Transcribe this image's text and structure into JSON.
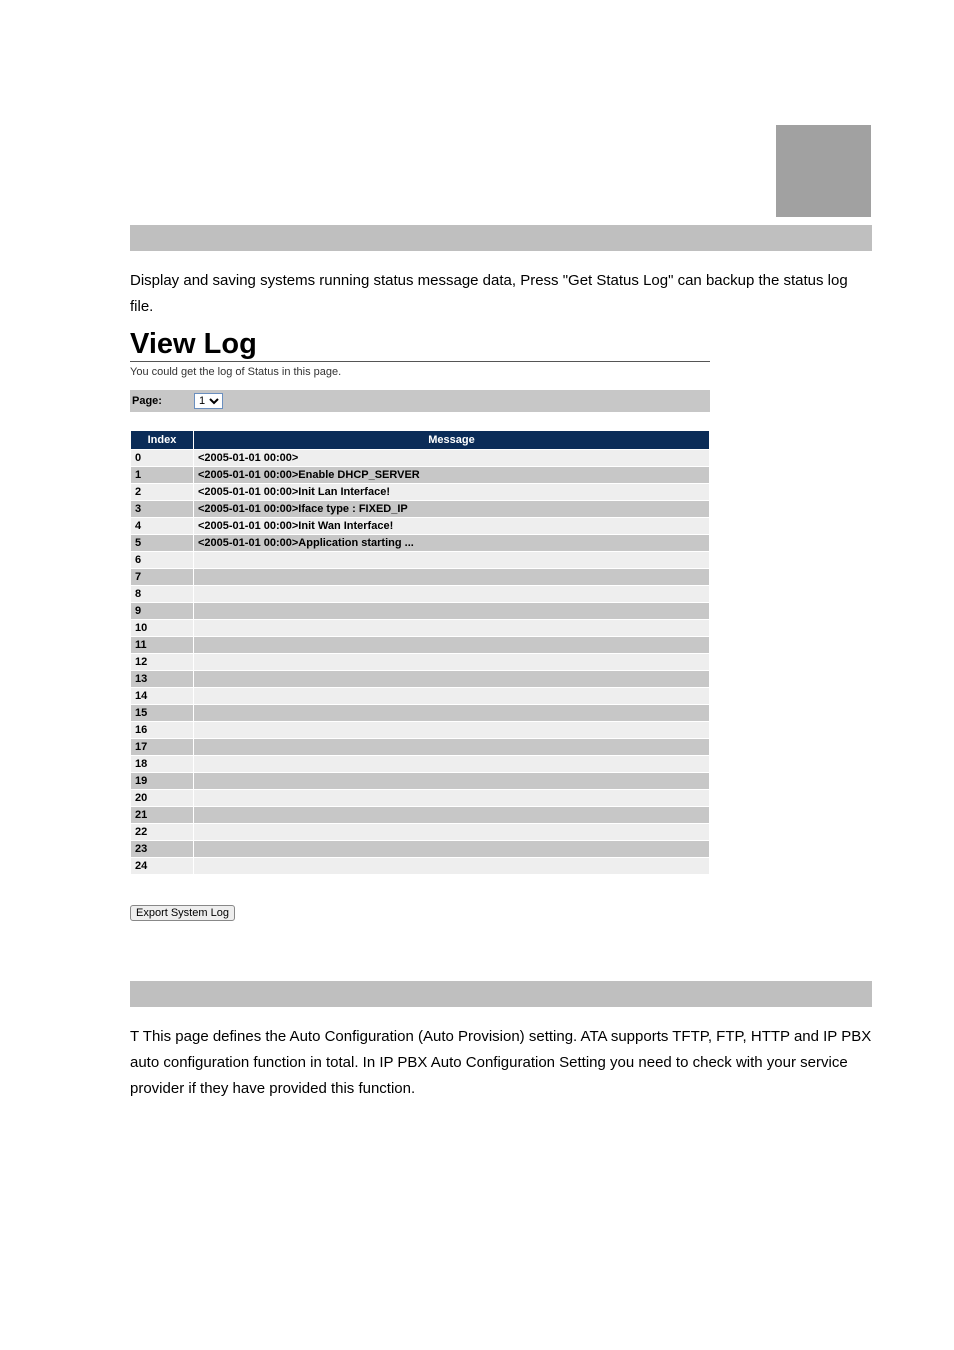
{
  "section1": {
    "intro": "Display and saving systems running status message data, Press \"Get Status Log\" can backup the status log file."
  },
  "viewlog": {
    "title_view": "V",
    "title_iew": "iew",
    "title_log": " Log",
    "subtitle": "You could get the log of Status in this page.",
    "page_label": "Page:",
    "page_options": [
      "1"
    ],
    "headers": {
      "index": "Index",
      "message": "Message"
    },
    "rows": [
      {
        "i": "0",
        "m": "<2005-01-01 00:00>"
      },
      {
        "i": "1",
        "m": "<2005-01-01 00:00>Enable DHCP_SERVER"
      },
      {
        "i": "2",
        "m": "<2005-01-01 00:00>Init Lan Interface!"
      },
      {
        "i": "3",
        "m": "<2005-01-01 00:00>Iface type : FIXED_IP"
      },
      {
        "i": "4",
        "m": "<2005-01-01 00:00>Init Wan Interface!"
      },
      {
        "i": "5",
        "m": "<2005-01-01 00:00>Application starting ..."
      },
      {
        "i": "6",
        "m": ""
      },
      {
        "i": "7",
        "m": ""
      },
      {
        "i": "8",
        "m": ""
      },
      {
        "i": "9",
        "m": ""
      },
      {
        "i": "10",
        "m": ""
      },
      {
        "i": "11",
        "m": ""
      },
      {
        "i": "12",
        "m": ""
      },
      {
        "i": "13",
        "m": ""
      },
      {
        "i": "14",
        "m": ""
      },
      {
        "i": "15",
        "m": ""
      },
      {
        "i": "16",
        "m": ""
      },
      {
        "i": "17",
        "m": ""
      },
      {
        "i": "18",
        "m": ""
      },
      {
        "i": "19",
        "m": ""
      },
      {
        "i": "20",
        "m": ""
      },
      {
        "i": "21",
        "m": ""
      },
      {
        "i": "22",
        "m": ""
      },
      {
        "i": "23",
        "m": ""
      },
      {
        "i": "24",
        "m": ""
      }
    ],
    "export_label": "Export System Log"
  },
  "section2": {
    "text": "T This page defines the Auto Configuration (Auto Provision) setting. ATA supports TFTP, FTP, HTTP and IP PBX auto configuration function in total. In IP PBX Auto Configuration Setting you need to check with your service provider if they have provided this function."
  }
}
